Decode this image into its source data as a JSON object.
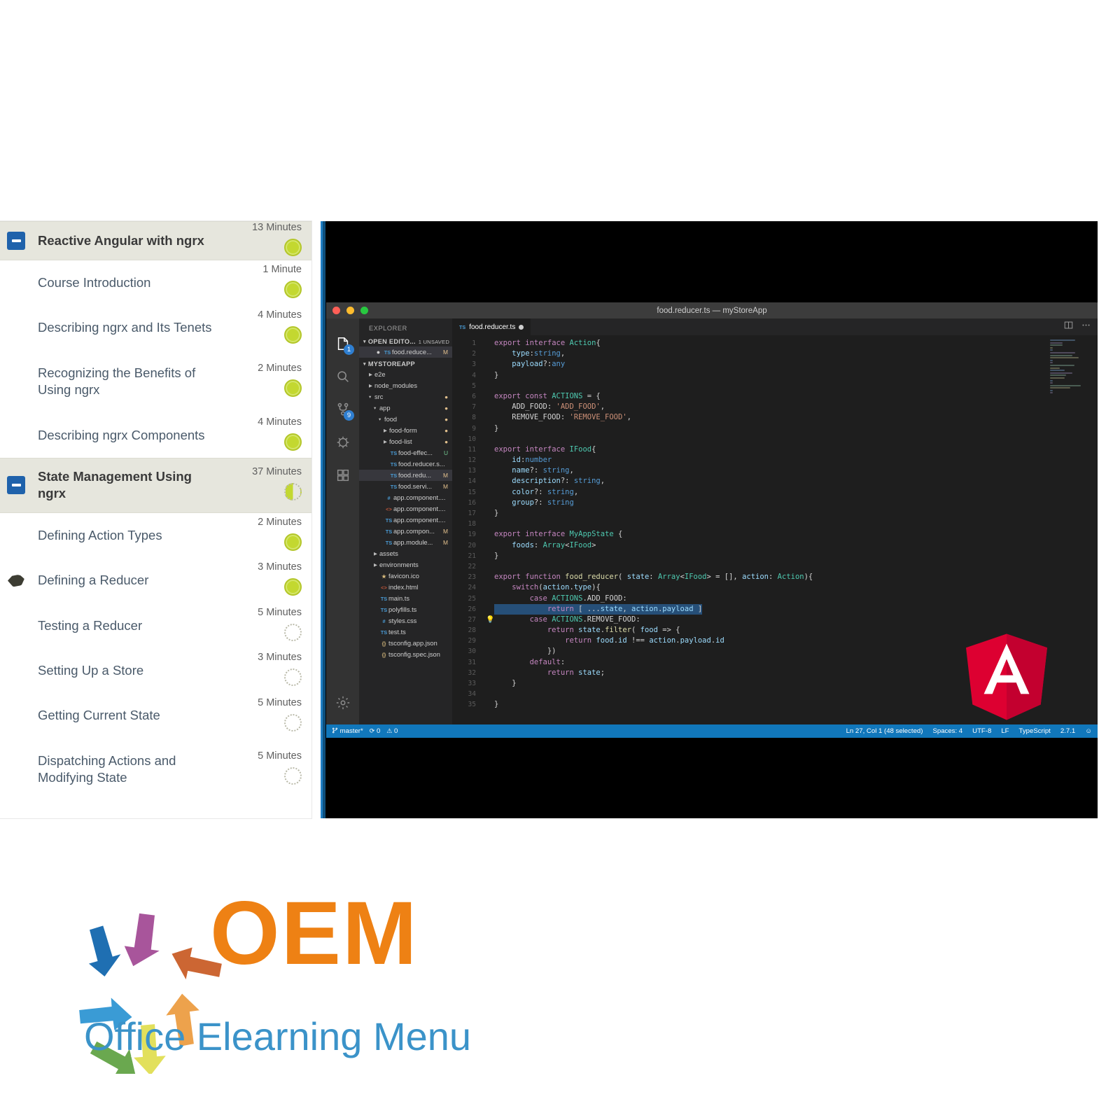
{
  "course": {
    "sections": [
      {
        "type": "section",
        "title": "Reactive Angular with ngrx",
        "duration": "13 Minutes",
        "status": "done"
      },
      {
        "type": "lesson",
        "title": "Course Introduction",
        "duration": "1 Minute",
        "status": "done"
      },
      {
        "type": "lesson",
        "title": "Describing ngrx and Its Tenets",
        "duration": "4 Minutes",
        "status": "done"
      },
      {
        "type": "lesson",
        "title": "Recognizing the Benefits of Using ngrx",
        "duration": "2 Minutes",
        "status": "done"
      },
      {
        "type": "lesson",
        "title": "Describing ngrx Components",
        "duration": "4 Minutes",
        "status": "done"
      },
      {
        "type": "section",
        "title": "State Management Using ngrx",
        "duration": "37 Minutes",
        "status": "half"
      },
      {
        "type": "lesson",
        "title": "Defining Action Types",
        "duration": "2 Minutes",
        "status": "done"
      },
      {
        "type": "lesson",
        "title": "Defining a Reducer",
        "duration": "3 Minutes",
        "status": "done",
        "playing": true
      },
      {
        "type": "lesson",
        "title": "Testing a Reducer",
        "duration": "5 Minutes",
        "status": "todo"
      },
      {
        "type": "lesson",
        "title": "Setting Up a Store",
        "duration": "3 Minutes",
        "status": "todo"
      },
      {
        "type": "lesson",
        "title": "Getting Current State",
        "duration": "5 Minutes",
        "status": "todo"
      },
      {
        "type": "lesson",
        "title": "Dispatching Actions and Modifying State",
        "duration": "5 Minutes",
        "status": "todo"
      }
    ]
  },
  "vscode": {
    "window_title": "food.reducer.ts — myStoreApp",
    "activity_bar": [
      {
        "name": "explorer",
        "badge": "1"
      },
      {
        "name": "search",
        "badge": ""
      },
      {
        "name": "source-control",
        "badge": "9"
      },
      {
        "name": "debug",
        "badge": ""
      },
      {
        "name": "extensions",
        "badge": ""
      }
    ],
    "sidebar": {
      "title": "EXPLORER",
      "open_editors_label": "OPEN EDITO...",
      "unsaved_label": "1 UNSAVED",
      "open_editor_file": "food.reduce...",
      "open_editor_state": "M",
      "project_label": "MYSTOREAPP",
      "tree": [
        {
          "indent": 1,
          "name": "e2e",
          "kind": "folder",
          "icon": "",
          "state": ""
        },
        {
          "indent": 1,
          "name": "node_modules",
          "kind": "folder",
          "icon": "",
          "state": ""
        },
        {
          "indent": 1,
          "name": "src",
          "kind": "folder-open",
          "icon": "",
          "state": "●"
        },
        {
          "indent": 2,
          "name": "app",
          "kind": "folder-open",
          "icon": "",
          "state": "●"
        },
        {
          "indent": 3,
          "name": "food",
          "kind": "folder-open",
          "icon": "",
          "state": "●"
        },
        {
          "indent": 4,
          "name": "food-form",
          "kind": "folder",
          "icon": "",
          "state": "●"
        },
        {
          "indent": 4,
          "name": "food-list",
          "kind": "folder",
          "icon": "",
          "state": "●"
        },
        {
          "indent": 4,
          "name": "food-effec...",
          "kind": "file",
          "icon": "TS",
          "state": "U"
        },
        {
          "indent": 4,
          "name": "food.reducer.s...",
          "kind": "file",
          "icon": "TS",
          "state": ""
        },
        {
          "indent": 4,
          "name": "food.redu...",
          "kind": "file",
          "icon": "TS",
          "state": "M",
          "selected": true
        },
        {
          "indent": 4,
          "name": "food.servi...",
          "kind": "file",
          "icon": "TS",
          "state": "M"
        },
        {
          "indent": 3,
          "name": "app.component....",
          "kind": "file",
          "icon": "#",
          "state": ""
        },
        {
          "indent": 3,
          "name": "app.component....",
          "kind": "file",
          "icon": "<>",
          "state": ""
        },
        {
          "indent": 3,
          "name": "app.component....",
          "kind": "file",
          "icon": "TS",
          "state": ""
        },
        {
          "indent": 3,
          "name": "app.compon...",
          "kind": "file",
          "icon": "TS",
          "state": "M"
        },
        {
          "indent": 3,
          "name": "app.module...",
          "kind": "file",
          "icon": "TS",
          "state": "M"
        },
        {
          "indent": 2,
          "name": "assets",
          "kind": "folder",
          "icon": "",
          "state": ""
        },
        {
          "indent": 2,
          "name": "environments",
          "kind": "folder",
          "icon": "",
          "state": ""
        },
        {
          "indent": 2,
          "name": "favicon.ico",
          "kind": "file",
          "icon": "★",
          "state": ""
        },
        {
          "indent": 2,
          "name": "index.html",
          "kind": "file",
          "icon": "<>",
          "state": ""
        },
        {
          "indent": 2,
          "name": "main.ts",
          "kind": "file",
          "icon": "TS",
          "state": ""
        },
        {
          "indent": 2,
          "name": "polyfills.ts",
          "kind": "file",
          "icon": "TS",
          "state": ""
        },
        {
          "indent": 2,
          "name": "styles.css",
          "kind": "file",
          "icon": "#",
          "state": ""
        },
        {
          "indent": 2,
          "name": "test.ts",
          "kind": "file",
          "icon": "TS",
          "state": ""
        },
        {
          "indent": 2,
          "name": "tsconfig.app.json",
          "kind": "file",
          "icon": "{}",
          "state": ""
        },
        {
          "indent": 2,
          "name": "tsconfig.spec.json",
          "kind": "file",
          "icon": "{}",
          "state": ""
        }
      ]
    },
    "tab": {
      "label": "food.reducer.ts",
      "icon": "TS",
      "dirty": true
    },
    "code_lines": [
      {
        "n": 1,
        "text": "export interface Action{"
      },
      {
        "n": 2,
        "text": "    type:string,"
      },
      {
        "n": 3,
        "text": "    payload?:any"
      },
      {
        "n": 4,
        "text": "}"
      },
      {
        "n": 5,
        "text": ""
      },
      {
        "n": 6,
        "text": "export const ACTIONS = {"
      },
      {
        "n": 7,
        "text": "    ADD_FOOD: 'ADD_FOOD',"
      },
      {
        "n": 8,
        "text": "    REMOVE_FOOD: 'REMOVE_FOOD',"
      },
      {
        "n": 9,
        "text": "}"
      },
      {
        "n": 10,
        "text": ""
      },
      {
        "n": 11,
        "text": "export interface IFood{"
      },
      {
        "n": 12,
        "text": "    id:number"
      },
      {
        "n": 13,
        "text": "    name?: string,"
      },
      {
        "n": 14,
        "text": "    description?: string,"
      },
      {
        "n": 15,
        "text": "    color?: string,"
      },
      {
        "n": 16,
        "text": "    group?: string"
      },
      {
        "n": 17,
        "text": "}"
      },
      {
        "n": 18,
        "text": ""
      },
      {
        "n": 19,
        "text": "export interface MyAppState {"
      },
      {
        "n": 20,
        "text": "    foods: Array<IFood>"
      },
      {
        "n": 21,
        "text": "}"
      },
      {
        "n": 22,
        "text": ""
      },
      {
        "n": 23,
        "text": "export function food_reducer( state: Array<IFood> = [], action: Action){"
      },
      {
        "n": 24,
        "text": "    switch(action.type){"
      },
      {
        "n": 25,
        "text": "        case ACTIONS.ADD_FOOD:"
      },
      {
        "n": 26,
        "text": "            return [ ...state, action.payload ]",
        "selected": true
      },
      {
        "n": 27,
        "text": "        case ACTIONS.REMOVE_FOOD:",
        "bulb": true
      },
      {
        "n": 28,
        "text": "            return state.filter( food => {"
      },
      {
        "n": 29,
        "text": "                return food.id !== action.payload.id"
      },
      {
        "n": 30,
        "text": "            })"
      },
      {
        "n": 31,
        "text": "        default:"
      },
      {
        "n": 32,
        "text": "            return state;"
      },
      {
        "n": 33,
        "text": "    }"
      },
      {
        "n": 34,
        "text": ""
      },
      {
        "n": 35,
        "text": "}"
      }
    ],
    "status_bar": {
      "branch": "master*",
      "sync": "0",
      "problems": "0",
      "cursor": "Ln 27, Col 1 (48 selected)",
      "spaces": "Spaces: 4",
      "encoding": "UTF-8",
      "eol": "LF",
      "language": "TypeScript",
      "version": "2.7.1"
    }
  },
  "branding": {
    "logo_title": "OEM",
    "logo_subtitle": "Office Elearning Menu",
    "accent_orange": "#ee8114",
    "accent_blue": "#3b93c9"
  }
}
